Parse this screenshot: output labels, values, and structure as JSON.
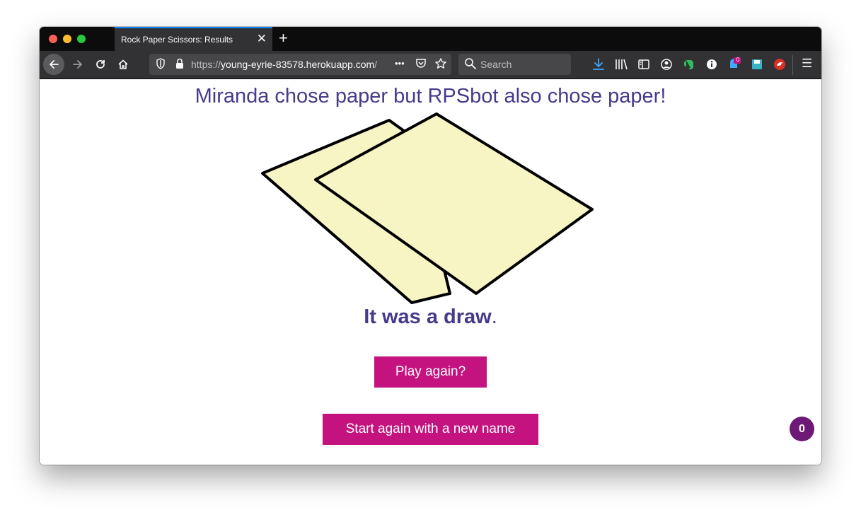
{
  "browser": {
    "tab_title": "Rock Paper Scissors: Results",
    "tab_close_glyph": "✕",
    "new_tab_glyph": "+",
    "url_scheme": "https://",
    "url_host": "young-eyrie-83578.herokuapp.com",
    "url_rest": "/",
    "page_actions_glyph": "•••",
    "search_placeholder": "Search",
    "menu_glyph": "☰",
    "badge_count": "0"
  },
  "page": {
    "headline": "Miranda chose paper but RPSbot also chose paper!",
    "result": "It was a draw",
    "result_punct": ".",
    "play_again_label": "Play again?",
    "new_name_label": "Start again with a new name",
    "counter": "0"
  },
  "colors": {
    "text_accent": "#463a8a",
    "button": "#c4137e",
    "counter_bg": "#6c1a75",
    "paper_fill": "#f8f5c5"
  }
}
